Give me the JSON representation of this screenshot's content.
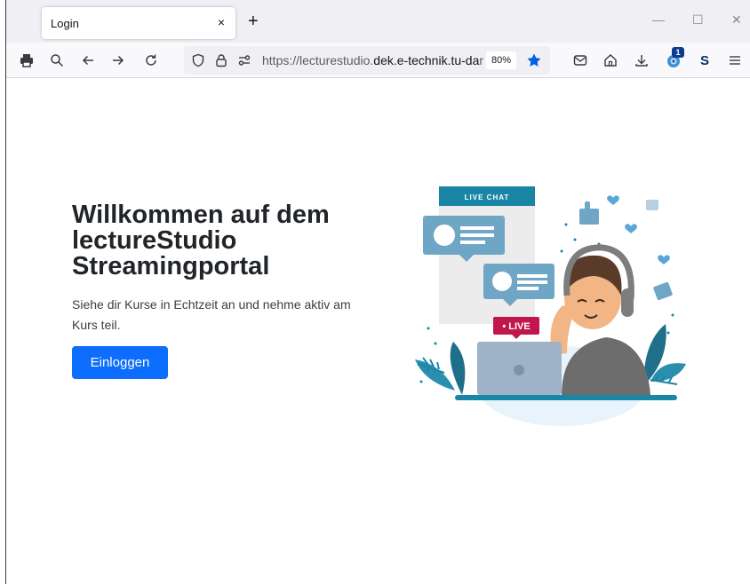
{
  "browser": {
    "tab": {
      "title": "Login",
      "close": "×"
    },
    "new_tab": "+",
    "window_controls": {
      "minimize": "—",
      "maximize": "☐",
      "close": "✕"
    },
    "url_prefix": "https://lecturestudio.",
    "url_domain": "dek.e-technik.tu-da",
    "url_suffix": "r",
    "zoom": "80%",
    "extension_badge": "1",
    "extension_s": "S",
    "accent": "#0060df"
  },
  "page": {
    "title_lines": [
      "Willkommen auf dem",
      "lectureStudio",
      "Streamingportal"
    ],
    "subtitle": "Siehe dir Kurse in Echtzeit an und nehme aktiv am Kurs teil.",
    "login_button": "Einloggen",
    "button_color": "#0d6efd"
  },
  "illustration": {
    "chat_header": "LIVE CHAT",
    "live_badge": "• LIVE"
  }
}
